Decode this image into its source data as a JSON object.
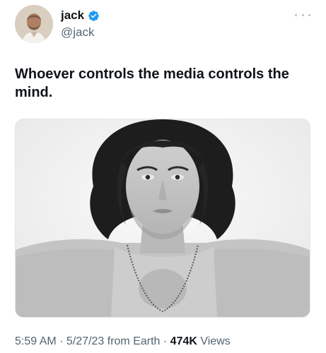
{
  "author": {
    "display_name": "jack",
    "handle": "@jack",
    "verified": true,
    "avatar_icon": "person-avatar"
  },
  "tweet": {
    "text": "Whoever controls the media controls the mind.",
    "media_description": "black-and-white portrait photo"
  },
  "meta": {
    "time": "5:59 AM",
    "sep1": " · ",
    "date": "5/27/23",
    "source": " from Earth",
    "sep2": " · ",
    "views_count": "474K",
    "views_label": " Views"
  },
  "colors": {
    "text": "#0f1419",
    "secondary": "#536471",
    "verified": "#1d9bf0"
  }
}
